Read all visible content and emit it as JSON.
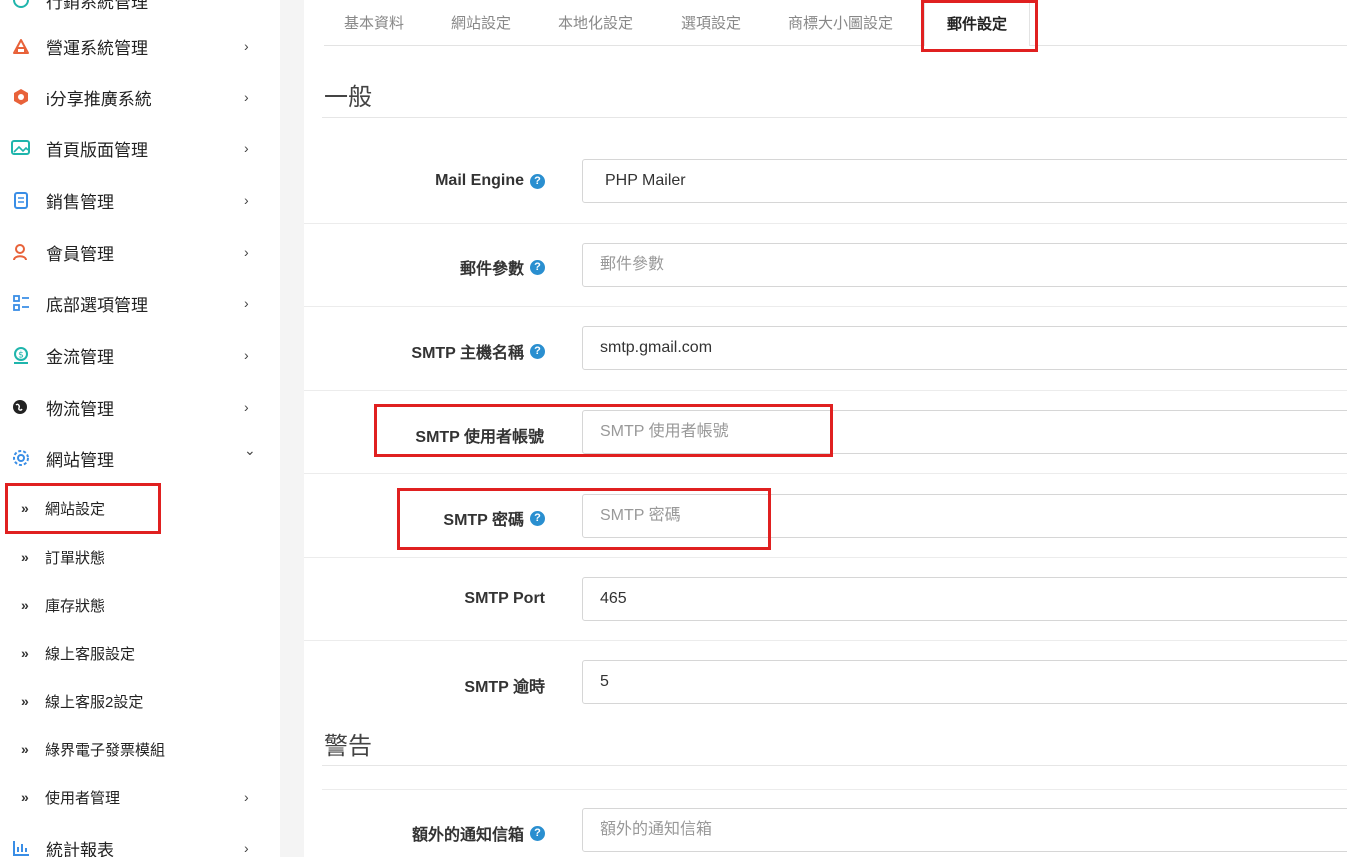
{
  "sidebar": {
    "top_items": [
      {
        "label": "行銷系統管理"
      },
      {
        "label": "營運系統管理"
      },
      {
        "label": "i分享推廣系統"
      },
      {
        "label": "首頁版面管理"
      },
      {
        "label": "銷售管理"
      },
      {
        "label": "會員管理"
      },
      {
        "label": "底部選項管理"
      },
      {
        "label": "金流管理"
      },
      {
        "label": "物流管理"
      },
      {
        "label": "網站管理"
      }
    ],
    "sub_items": [
      {
        "label": "網站設定"
      },
      {
        "label": "訂單狀態"
      },
      {
        "label": "庫存狀態"
      },
      {
        "label": "線上客服設定"
      },
      {
        "label": "線上客服2設定"
      },
      {
        "label": "綠界電子發票模組"
      },
      {
        "label": "使用者管理"
      }
    ],
    "bottom_item": {
      "label": "統計報表"
    },
    "chevron_right": "›",
    "chevron_down": "⌄",
    "raquo": "»"
  },
  "tabs": [
    {
      "label": "基本資料"
    },
    {
      "label": "網站設定"
    },
    {
      "label": "本地化設定"
    },
    {
      "label": "選項設定"
    },
    {
      "label": "商標大小圖設定"
    },
    {
      "label": "郵件設定",
      "active": true
    }
  ],
  "sections": {
    "general": "一般",
    "warning": "警告"
  },
  "fields": {
    "mail_engine": {
      "label": "Mail Engine",
      "value": "PHP Mailer",
      "help": "?"
    },
    "mail_params": {
      "label": "郵件參數",
      "value": "",
      "placeholder": "郵件參數",
      "help": "?"
    },
    "smtp_host": {
      "label": "SMTP 主機名稱",
      "value": "smtp.gmail.com",
      "help": "?"
    },
    "smtp_user": {
      "label": "SMTP 使用者帳號",
      "value": "",
      "placeholder": "SMTP 使用者帳號"
    },
    "smtp_pass": {
      "label": "SMTP 密碼",
      "value": "",
      "placeholder": "SMTP 密碼",
      "help": "?"
    },
    "smtp_port": {
      "label": "SMTP Port",
      "value": "465"
    },
    "smtp_timeout": {
      "label": "SMTP 逾時",
      "value": "5"
    },
    "extra_alert": {
      "label": "額外的通知信箱",
      "value": "",
      "placeholder": "額外的通知信箱",
      "help": "?"
    }
  },
  "colors": {
    "accent_blue": "#2a8fd0",
    "highlight_red": "#e02020",
    "icon_orange": "#e8623a",
    "icon_teal": "#1fb5ac",
    "icon_blue": "#3a8ee6"
  }
}
